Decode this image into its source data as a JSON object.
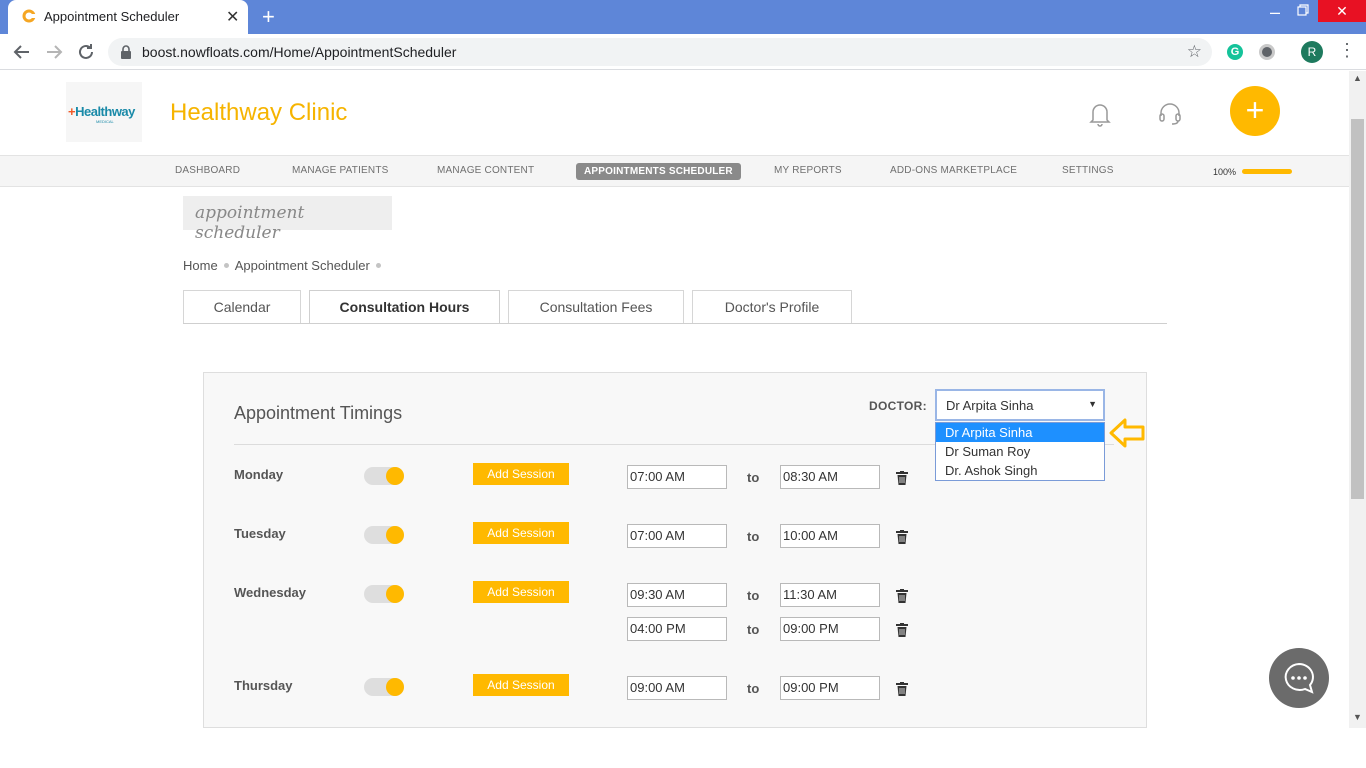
{
  "browser": {
    "tab_title": "Appointment Scheduler",
    "url": "boost.nowfloats.com/Home/AppointmentScheduler",
    "profile_initial": "R",
    "grammarly_letter": "G"
  },
  "header": {
    "logo_text_main": "Healthway",
    "logo_text_sub": "MEDICAL",
    "clinic_name": "Healthway Clinic",
    "accent_color": "#f6b400"
  },
  "nav": {
    "items": [
      "DASHBOARD",
      "MANAGE PATIENTS",
      "MANAGE CONTENT",
      "APPOINTMENTS SCHEDULER",
      "MY REPORTS",
      "ADD-ONS MARKETPLACE",
      "SETTINGS"
    ],
    "active_index": 3,
    "progress_label": "100%",
    "progress_value": 1.0
  },
  "page": {
    "heading": "appointment scheduler",
    "breadcrumb": [
      "Home",
      "Appointment Scheduler"
    ]
  },
  "tabs": [
    "Calendar",
    "Consultation Hours",
    "Consultation Fees",
    "Doctor's Profile"
  ],
  "active_tab": 1,
  "panel": {
    "title": "Appointment Timings",
    "doctor_label": "DOCTOR:",
    "doctor_selected": "Dr Arpita Sinha",
    "doctor_options": [
      "Dr Arpita Sinha",
      "Dr Suman Roy",
      "Dr. Ashok Singh"
    ],
    "add_session_label": "Add Session",
    "to_label": "to",
    "schedule": [
      {
        "day": "Monday",
        "enabled": true,
        "sessions": [
          {
            "from": "07:00 AM",
            "to": "08:30 AM"
          }
        ]
      },
      {
        "day": "Tuesday",
        "enabled": true,
        "sessions": [
          {
            "from": "07:00 AM",
            "to": "10:00 AM"
          }
        ]
      },
      {
        "day": "Wednesday",
        "enabled": true,
        "sessions": [
          {
            "from": "09:30 AM",
            "to": "11:30 AM"
          },
          {
            "from": "04:00 PM",
            "to": "09:00 PM"
          }
        ]
      },
      {
        "day": "Thursday",
        "enabled": true,
        "sessions": [
          {
            "from": "09:00 AM",
            "to": "09:00 PM"
          }
        ]
      }
    ]
  }
}
